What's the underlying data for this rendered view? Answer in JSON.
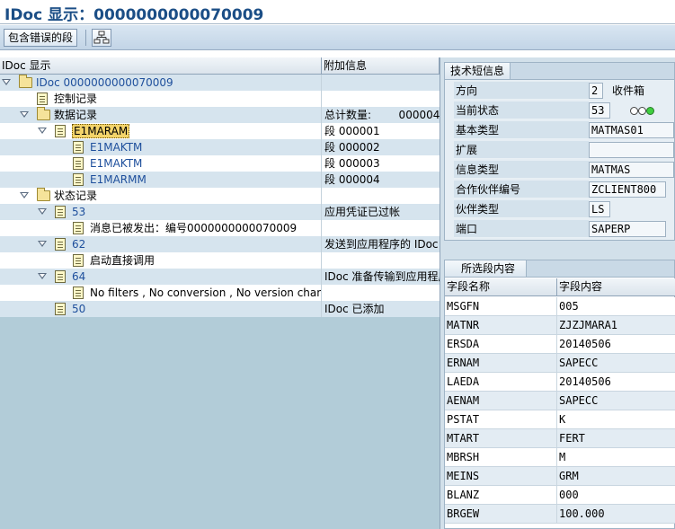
{
  "window": {
    "title": "IDoc 显示：0000000000070009"
  },
  "toolbar": {
    "include_error_segments": "包含错误的段",
    "icon": "hierarchy-icon"
  },
  "tree": {
    "col1": "IDoc 显示",
    "col2": "附加信息",
    "rows": [
      {
        "level": 0,
        "node": "folder",
        "expanded": true,
        "label": "IDoc 0000000000070009",
        "blue": true,
        "info": ""
      },
      {
        "level": 1,
        "node": "doc",
        "label": "控制记录",
        "info": ""
      },
      {
        "level": 1,
        "node": "folder",
        "expanded": true,
        "label": "数据记录",
        "info": "总计数量:        000004"
      },
      {
        "level": 2,
        "node": "doc",
        "expanded": true,
        "label": "E1MARAM",
        "selected": true,
        "info": "段 000001"
      },
      {
        "level": 3,
        "node": "doc",
        "label": "E1MAKTM",
        "blue": true,
        "info": "段 000002"
      },
      {
        "level": 3,
        "node": "doc",
        "label": "E1MAKTM",
        "blue": true,
        "info": "段 000003"
      },
      {
        "level": 3,
        "node": "doc",
        "label": "E1MARMM",
        "blue": true,
        "info": "段 000004"
      },
      {
        "level": 1,
        "node": "folder",
        "expanded": true,
        "label": "状态记录",
        "info": ""
      },
      {
        "level": 2,
        "node": "doc",
        "expanded": true,
        "label": "53",
        "blue": true,
        "info": "应用凭证已过帐"
      },
      {
        "level": 3,
        "node": "doc",
        "label": "消息已被发出：编号0000000000070009",
        "info": ""
      },
      {
        "level": 2,
        "node": "doc",
        "expanded": true,
        "label": "62",
        "blue": true,
        "info": "发送到应用程序的 IDoc"
      },
      {
        "level": 3,
        "node": "doc",
        "label": "启动直接调用",
        "info": ""
      },
      {
        "level": 2,
        "node": "doc",
        "expanded": true,
        "label": "64",
        "blue": true,
        "info": "IDoc 准备传输到应用程序"
      },
      {
        "level": 3,
        "node": "doc",
        "label": "No filters , No conversion , No version change .",
        "info": ""
      },
      {
        "level": 2,
        "node": "doc",
        "label": "50",
        "blue": true,
        "info": "IDoc 已添加"
      }
    ]
  },
  "tech": {
    "title": "技术短信息",
    "direction_label": "方向",
    "direction_value": "2",
    "direction_text": "收件箱",
    "status_label": "当前状态",
    "status_value": "53",
    "status_lights": [
      "off",
      "off",
      "green"
    ],
    "basic_type_label": "基本类型",
    "basic_type_value": "MATMAS01",
    "extension_label": "扩展",
    "extension_value": "",
    "message_type_label": "信息类型",
    "message_type_value": "MATMAS",
    "partner_label": "合作伙伴编号",
    "partner_value": "ZCLIENT800",
    "partner_type_label": "伙伴类型",
    "partner_type_value": "LS",
    "port_label": "端口",
    "port_value": "SAPERP"
  },
  "segment": {
    "title": "所选段内容",
    "col1": "字段名称",
    "col2": "字段内容",
    "rows": [
      {
        "field": "MSGFN",
        "value": "005"
      },
      {
        "field": "MATNR",
        "value": "ZJZJMARA1"
      },
      {
        "field": "ERSDA",
        "value": "20140506"
      },
      {
        "field": "ERNAM",
        "value": "SAPECC"
      },
      {
        "field": "LAEDA",
        "value": "20140506"
      },
      {
        "field": "AENAM",
        "value": "SAPECC"
      },
      {
        "field": "PSTAT",
        "value": "K"
      },
      {
        "field": "MTART",
        "value": "FERT"
      },
      {
        "field": "MBRSH",
        "value": "M"
      },
      {
        "field": "MEINS",
        "value": "GRM"
      },
      {
        "field": "BLANZ",
        "value": "000"
      },
      {
        "field": "BRGEW",
        "value": "100.000"
      }
    ]
  }
}
